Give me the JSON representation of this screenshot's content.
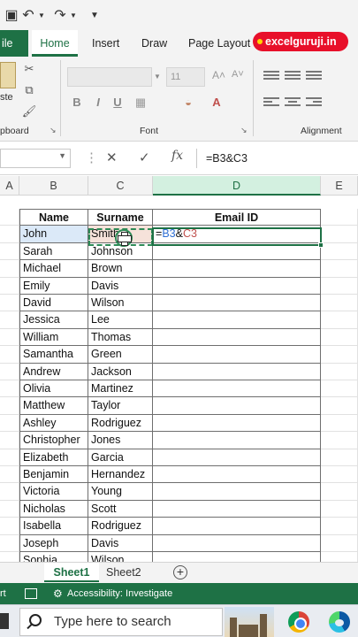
{
  "ribbon": {
    "tabs": {
      "file": "ile",
      "home": "Home",
      "insert": "Insert",
      "draw": "Draw",
      "page_layout": "Page Layout"
    },
    "brand": "excelguruji.in",
    "paste_label": "ste",
    "clipboard_label": "pboard",
    "font_label": "Font",
    "font_size": "11",
    "alignment_label": "Alignment",
    "bold": "B",
    "italic": "I",
    "underline": "U",
    "grow_font": "A˄",
    "shrink_font": "A˅"
  },
  "formula_bar": {
    "cancel": "✕",
    "enter": "✓",
    "fx": "fx",
    "formula": "=B3&C3"
  },
  "columns": [
    "A",
    "B",
    "C",
    "D",
    "E"
  ],
  "active_column": "D",
  "table": {
    "headers": {
      "name": "Name",
      "surname": "Surname",
      "email": "Email ID"
    },
    "editing": {
      "eq": "=",
      "ref_b": "B3",
      "amp": "&",
      "ref_c": "C3"
    },
    "rows": [
      {
        "name": "John",
        "surname": "Smith"
      },
      {
        "name": "Sarah",
        "surname": "Johnson"
      },
      {
        "name": "Michael",
        "surname": "Brown"
      },
      {
        "name": "Emily",
        "surname": "Davis"
      },
      {
        "name": "David",
        "surname": "Wilson"
      },
      {
        "name": "Jessica",
        "surname": "Lee"
      },
      {
        "name": "William",
        "surname": "Thomas"
      },
      {
        "name": "Samantha",
        "surname": "Green"
      },
      {
        "name": "Andrew",
        "surname": "Jackson"
      },
      {
        "name": "Olivia",
        "surname": "Martinez"
      },
      {
        "name": "Matthew",
        "surname": "Taylor"
      },
      {
        "name": "Ashley",
        "surname": "Rodriguez"
      },
      {
        "name": "Christopher",
        "surname": "Jones"
      },
      {
        "name": "Elizabeth",
        "surname": "Garcia"
      },
      {
        "name": "Benjamin",
        "surname": "Hernandez"
      },
      {
        "name": "Victoria",
        "surname": "Young"
      },
      {
        "name": "Nicholas",
        "surname": "Scott"
      },
      {
        "name": "Isabella",
        "surname": "Rodriguez"
      },
      {
        "name": "Joseph",
        "surname": "Davis"
      },
      {
        "name": "Sophia",
        "surname": "Wilson"
      }
    ]
  },
  "sheets": [
    "Sheet1",
    "Sheet2"
  ],
  "add_sheet": "+",
  "status": {
    "mode": "rt",
    "accessibility": "Accessibility: Investigate"
  },
  "taskbar": {
    "search_placeholder": "Type here to search"
  }
}
